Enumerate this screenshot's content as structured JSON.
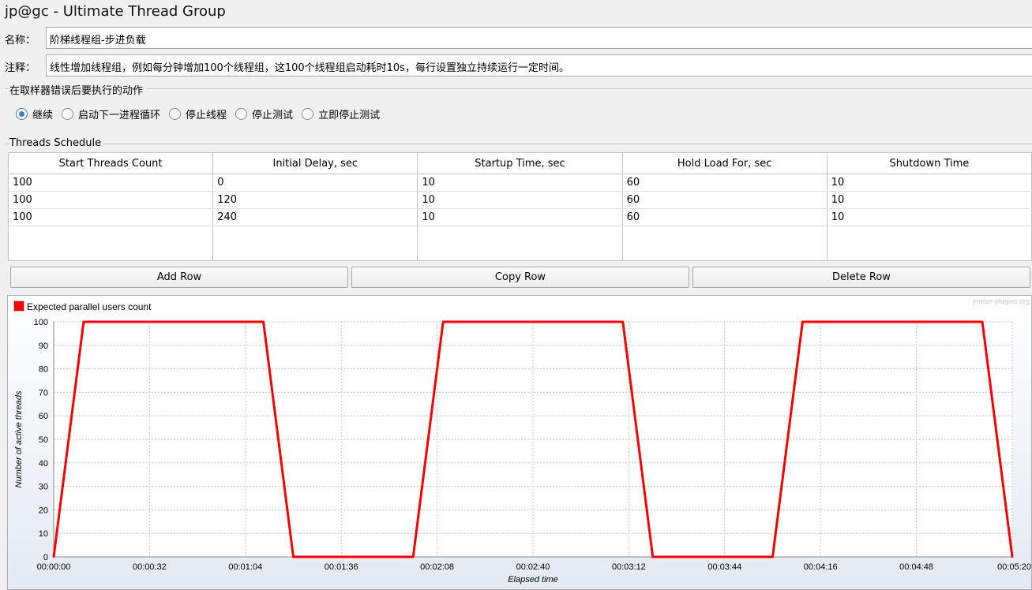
{
  "window": {
    "title": "jp@gc - Ultimate Thread Group"
  },
  "name_field": {
    "label": "名称：",
    "value": "阶梯线程组-步进负载"
  },
  "comment_field": {
    "label": "注释：",
    "value": "线性增加线程组，例如每分钟增加100个线程组，这100个线程组启动耗时10s，每行设置独立持续运行一定时间。"
  },
  "on_error": {
    "group_title": "在取样器错误后要执行的动作",
    "options": [
      {
        "label": "继续",
        "selected": true
      },
      {
        "label": "启动下一进程循环",
        "selected": false
      },
      {
        "label": "停止线程",
        "selected": false
      },
      {
        "label": "停止测试",
        "selected": false
      },
      {
        "label": "立即停止测试",
        "selected": false
      }
    ]
  },
  "schedule": {
    "group_title": "Threads Schedule",
    "columns": [
      "Start Threads Count",
      "Initial Delay, sec",
      "Startup Time, sec",
      "Hold Load For, sec",
      "Shutdown Time"
    ],
    "rows": [
      [
        "100",
        "0",
        "10",
        "60",
        "10"
      ],
      [
        "100",
        "120",
        "10",
        "60",
        "10"
      ],
      [
        "100",
        "240",
        "10",
        "60",
        "10"
      ]
    ]
  },
  "buttons": {
    "add": "Add Row",
    "copy": "Copy Row",
    "delete": "Delete Row"
  },
  "colors": {
    "series": "#ff0000",
    "accent": "#3c7fb1"
  },
  "chart_data": {
    "type": "line",
    "watermark": "jmeter-plugins.org",
    "xlabel": "Elapsed time",
    "ylabel": "Number of active threads",
    "xlim": [
      0,
      320
    ],
    "ylim": [
      0,
      100
    ],
    "x_ticks": [
      {
        "value": 0,
        "label": "00:00:00"
      },
      {
        "value": 32,
        "label": "00:00:32"
      },
      {
        "value": 64,
        "label": "00:01:04"
      },
      {
        "value": 96,
        "label": "00:01:36"
      },
      {
        "value": 128,
        "label": "00:02:08"
      },
      {
        "value": 160,
        "label": "00:02:40"
      },
      {
        "value": 192,
        "label": "00:03:12"
      },
      {
        "value": 224,
        "label": "00:03:44"
      },
      {
        "value": 256,
        "label": "00:04:16"
      },
      {
        "value": 288,
        "label": "00:04:48"
      },
      {
        "value": 320,
        "label": "00:05:20"
      }
    ],
    "y_ticks": [
      0,
      10,
      20,
      30,
      40,
      50,
      60,
      70,
      80,
      90,
      100
    ],
    "grid": true,
    "legend": "top-left",
    "series": [
      {
        "name": "Expected parallel users count",
        "x": [
          0,
          10,
          70,
          80,
          120,
          130,
          190,
          200,
          240,
          250,
          310,
          320
        ],
        "y": [
          0,
          100,
          100,
          0,
          0,
          100,
          100,
          0,
          0,
          100,
          100,
          0
        ]
      }
    ]
  }
}
